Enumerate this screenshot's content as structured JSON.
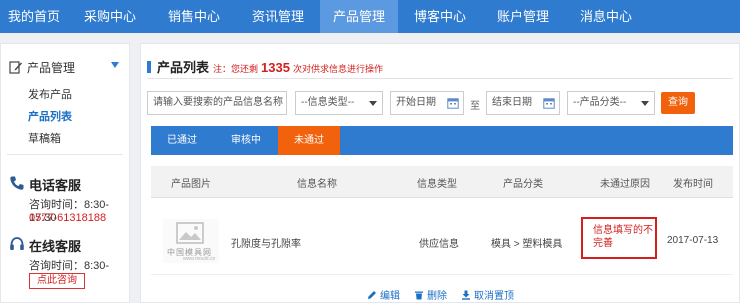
{
  "nav": {
    "items": [
      "我的首页",
      "采购中心",
      "销售中心",
      "资讯管理",
      "产品管理",
      "博客中心",
      "账户管理",
      "消息中心"
    ],
    "active_index": 4
  },
  "sidebar": {
    "section_title": "产品管理",
    "links": [
      "发布产品",
      "产品列表",
      "草稿箱"
    ],
    "active_link": 1,
    "phone_service": {
      "title": "电话客服",
      "hours": "咨询时间：8:30-17:30",
      "phone": "0577-61318188"
    },
    "online_service": {
      "title": "在线客服",
      "hours": "咨询时间：8:30-17:30",
      "button": "点此咨询"
    }
  },
  "main": {
    "title": "产品列表",
    "note_prefix": "注：您还剩",
    "remaining_count": "1335",
    "note_suffix": "次对供求信息进行操作"
  },
  "filters": {
    "search_placeholder": "请输入要搜索的产品信息名称",
    "type_select": "--信息类型--",
    "start_date": "开始日期",
    "to": "至",
    "end_date": "结束日期",
    "category_select": "--产品分类--",
    "query_button": "查询"
  },
  "tabs": {
    "labels": [
      "已通过",
      "审核中",
      "未通过"
    ],
    "active_index": 2
  },
  "table": {
    "headers": [
      "产品图片",
      "信息名称",
      "信息类型",
      "产品分类",
      "未通过原因",
      "发布时间"
    ],
    "row": {
      "thumb_text": "中国模具网",
      "thumb_sub": "www.mould.cn",
      "name": "孔隙度与孔隙率",
      "type": "供应信息",
      "category": "模具 > 塑料模具",
      "reason": "信息填写的不完善",
      "date": "2017-07-13"
    },
    "actions": {
      "edit": "编辑",
      "delete": "删除",
      "unpin": "取消置顶"
    }
  },
  "colors": {
    "nav_bg": "#2f7bd0",
    "accent": "#f2620c",
    "alert": "#d21f1f"
  }
}
